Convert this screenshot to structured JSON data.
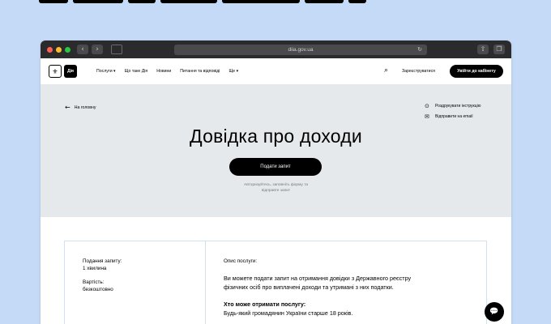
{
  "browser": {
    "url": "diia.gov.ua",
    "back_icon": "chevron-left",
    "forward_icon": "chevron-right",
    "reload_icon": "reload",
    "share_icon": "share",
    "tabs_icon": "tabs"
  },
  "header": {
    "logo_trident": "trident-logo",
    "logo_text": "Дія",
    "menu": [
      "Послуги ▾",
      "Що таке Дія",
      "Новини",
      "Питання та відповіді",
      "Ще ▾"
    ],
    "search_icon": "search",
    "register_label": "Зареєструватися",
    "cabinet_label": "Увійти до кабінету"
  },
  "hero": {
    "back_label": "На головну",
    "print_label": "Роздрукувати інструкцію",
    "email_label": "Відправити на email",
    "title": "Довідка про доходи",
    "cta_label": "Подати запит",
    "hint_line1": "Авторизуйтесь, заповніть форму та",
    "hint_line2": "відправте запит"
  },
  "details": {
    "time_label": "Подання запиту:",
    "time_value": "1 хвилина",
    "cost_label": "Вартість:",
    "cost_value": "безкоштовно",
    "desc_label": "Опис послуги:",
    "desc_line1": "Ви можете подати запит на отримання довідки з Державного реєстру",
    "desc_line2": "фізичних осіб про виплачені доходи та утримані з них податки.",
    "who_title": "Хто може отримати послугу:",
    "who_text": "Будь-який громадянин України старше 18 років."
  },
  "colors": {
    "page_background": "#c5daf7",
    "hero_background": "#e6e9ec",
    "accent": "#000000"
  }
}
